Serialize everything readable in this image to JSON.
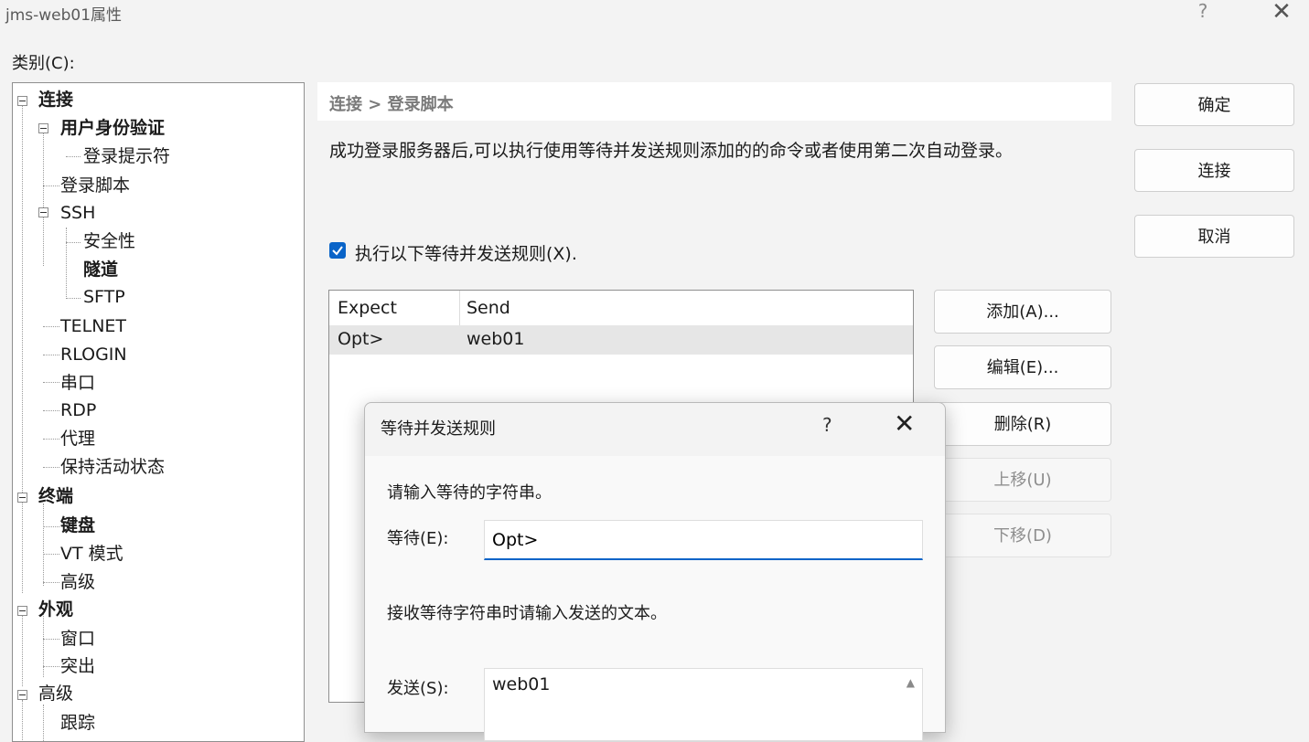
{
  "window": {
    "title": "jms-web01属性",
    "help": "?",
    "close": "✕"
  },
  "category_label": "类别(C):",
  "tree": [
    {
      "label": "连接",
      "bold": true
    },
    {
      "label": "用户身份验证",
      "bold": true
    },
    {
      "label": "登录提示符",
      "bold": false
    },
    {
      "label": "登录脚本",
      "bold": false
    },
    {
      "label": "SSH",
      "bold": false
    },
    {
      "label": "安全性",
      "bold": false
    },
    {
      "label": "隧道",
      "bold": true
    },
    {
      "label": "SFTP",
      "bold": false
    },
    {
      "label": "TELNET",
      "bold": false
    },
    {
      "label": "RLOGIN",
      "bold": false
    },
    {
      "label": "串口",
      "bold": false
    },
    {
      "label": "RDP",
      "bold": false
    },
    {
      "label": "代理",
      "bold": false
    },
    {
      "label": "保持活动状态",
      "bold": false
    },
    {
      "label": "终端",
      "bold": true
    },
    {
      "label": "键盘",
      "bold": true
    },
    {
      "label": "VT 模式",
      "bold": false
    },
    {
      "label": "高级",
      "bold": false
    },
    {
      "label": "外观",
      "bold": true
    },
    {
      "label": "窗口",
      "bold": false
    },
    {
      "label": "突出",
      "bold": false
    },
    {
      "label": "高级",
      "bold": false
    },
    {
      "label": "跟踪",
      "bold": false
    }
  ],
  "breadcrumb": "连接 > 登录脚本",
  "description": "成功登录服务器后,可以执行使用等待并发送规则添加的的命令或者使用第二次自动登录。",
  "checkbox": {
    "label": "执行以下等待并发送规则(X).",
    "checked": true
  },
  "rules_table": {
    "headers": [
      "Expect",
      "Send"
    ],
    "rows": [
      [
        "Opt>",
        "web01"
      ]
    ]
  },
  "side_buttons": {
    "ok": "确定",
    "connect": "连接",
    "cancel": "取消"
  },
  "rule_buttons": {
    "add": "添加(A)...",
    "edit": "编辑(E)...",
    "delete": "删除(R)",
    "up": "上移(U)",
    "down": "下移(D)"
  },
  "dialog": {
    "title": "等待并发送规则",
    "help": "?",
    "close": "✕",
    "prompt_wait": "请输入等待的字符串。",
    "wait_label": "等待(E):",
    "wait_value": "Opt>",
    "prompt_send": "接收等待字符串时请输入发送的文本。",
    "send_label": "发送(S):",
    "send_value": "web01"
  }
}
